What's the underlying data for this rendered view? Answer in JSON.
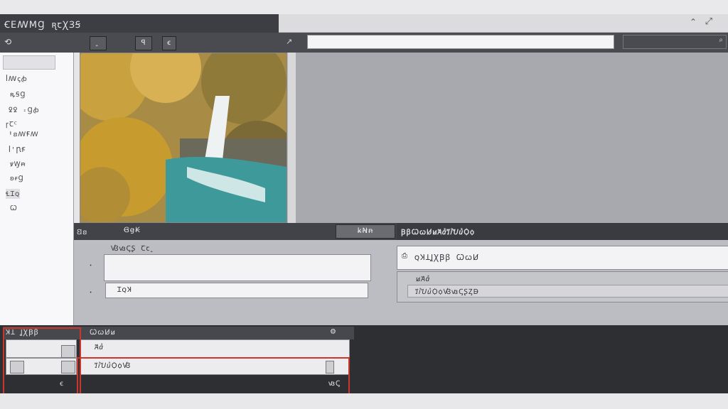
{
  "window": {
    "title": "ꞒꓰꟿꓟꞬ ꭆꞇꞳꞫꞨ"
  },
  "toolbar": {
    "buttons": [
      "ꞈ",
      "ꟼ",
      "ꞓ"
    ],
    "search_placeholder": ""
  },
  "sidebar": {
    "items": [
      "ꟾꟿꞔꞗ",
      "ꝶꞨꞬ",
      "ꝿꝿ ꞊Ɡꞗ",
      "ꞅꞆꟲ",
      "ꞋꞛꟿꞘꟿ",
      "ꟾꞌꞂꞘ",
      "ꝟꝠꞥ",
      "ꞝꞧꞬ",
      "ꞭꞮꞯ",
      "Ꞷ"
    ]
  },
  "strip": {
    "left_labels": [
      "Ꞛꞛ",
      "ꞠꞡꞢ"
    ],
    "buttons": [
      "ꞣꞤꞥ"
    ],
    "tab_title": "ꞴꞵꞶꞷꞸꞹꞺꞻꞼꞽꞾꞿꟀꟁ"
  },
  "form": {
    "heading": "ꟂꟃꟄꟅ Ꞇꞇꞈ",
    "field1_value": "",
    "field2_value": "ꞮꞯꞰ",
    "right_title": "ꞯꞰꞱꞲꞳꞴꞵ ꞶꞷꞸ",
    "right_sub": "ꞹꞺꞻ",
    "right_desc": "ꞼꞽꞾꞿꟀꟁꟂꟃꟄꟅꟆꟇ"
  },
  "bottom": {
    "left_header": "ꞰꞱ ꞲꞳꞴꞵ",
    "mid_header": "ꞶꞷꞸꞹ",
    "row1": "Ꞻꞻ",
    "row2": "ꞼꞽꞾꞿꟀꟁꟂ",
    "count": "ꟃꟄ"
  },
  "colors": {
    "accent": "#c9362c",
    "dark": "#2e2f33"
  }
}
